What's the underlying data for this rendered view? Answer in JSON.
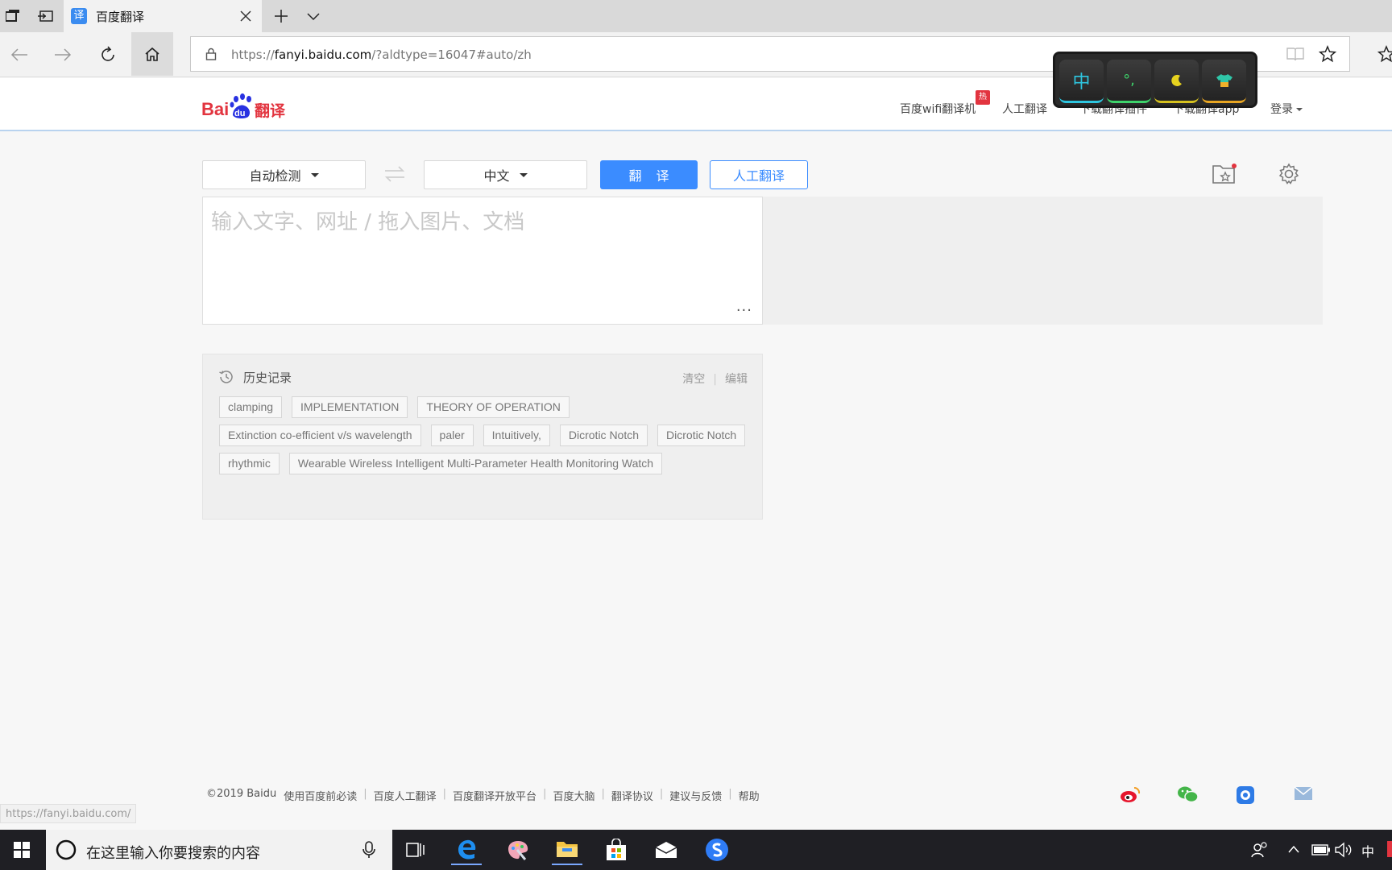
{
  "browser": {
    "tab_title": "百度翻译",
    "tab_favicon": "译",
    "url_host": "fanyi.baidu.com",
    "url_prefix": "https://",
    "url_suffix": "/?aldtype=16047#auto/zh"
  },
  "ime_widget": {
    "keys": [
      "中",
      "°,",
      "moon-icon",
      "shirt-icon"
    ],
    "label_zh": "中",
    "label_punct": "°,"
  },
  "header": {
    "logo_alt": "Baidu翻译",
    "links": [
      "百度wifi翻译机",
      "人工翻译",
      "下载翻译插件",
      "下载翻译app",
      "登录"
    ],
    "hot_badge": "热"
  },
  "controls": {
    "source_lang": "自动检测",
    "target_lang": "中文",
    "translate_button": "翻译",
    "human_button": "人工翻译"
  },
  "input": {
    "placeholder": "输入文字、网址 / 拖入图片、文档",
    "more": "···"
  },
  "history": {
    "title": "历史记录",
    "clear": "清空",
    "edit": "编辑",
    "items": [
      "clamping",
      "IMPLEMENTATION",
      "THEORY OF OPERATION",
      "Extinction co-efficient v/s wavelength",
      "paler",
      "Intuitively,",
      "Dicrotic Notch",
      "Dicrotic Notch",
      "rhythmic",
      "Wearable Wireless Intelligent Multi-Parameter Health Monitoring Watch"
    ]
  },
  "footer": {
    "copyright": "©2019 Baidu",
    "links": [
      "使用百度前必读",
      "百度人工翻译",
      "百度翻译开放平台",
      "百度大脑",
      "翻译协议",
      "建议与反馈",
      "帮助"
    ]
  },
  "status_url": "https://fanyi.baidu.com/",
  "taskbar": {
    "search_placeholder": "在这里输入你要搜索的内容",
    "ime_indicator": "中"
  },
  "colors": {
    "brand_blue": "#3b8cff",
    "baidu_red": "#e2343f",
    "baidu_blue": "#2932e1"
  }
}
